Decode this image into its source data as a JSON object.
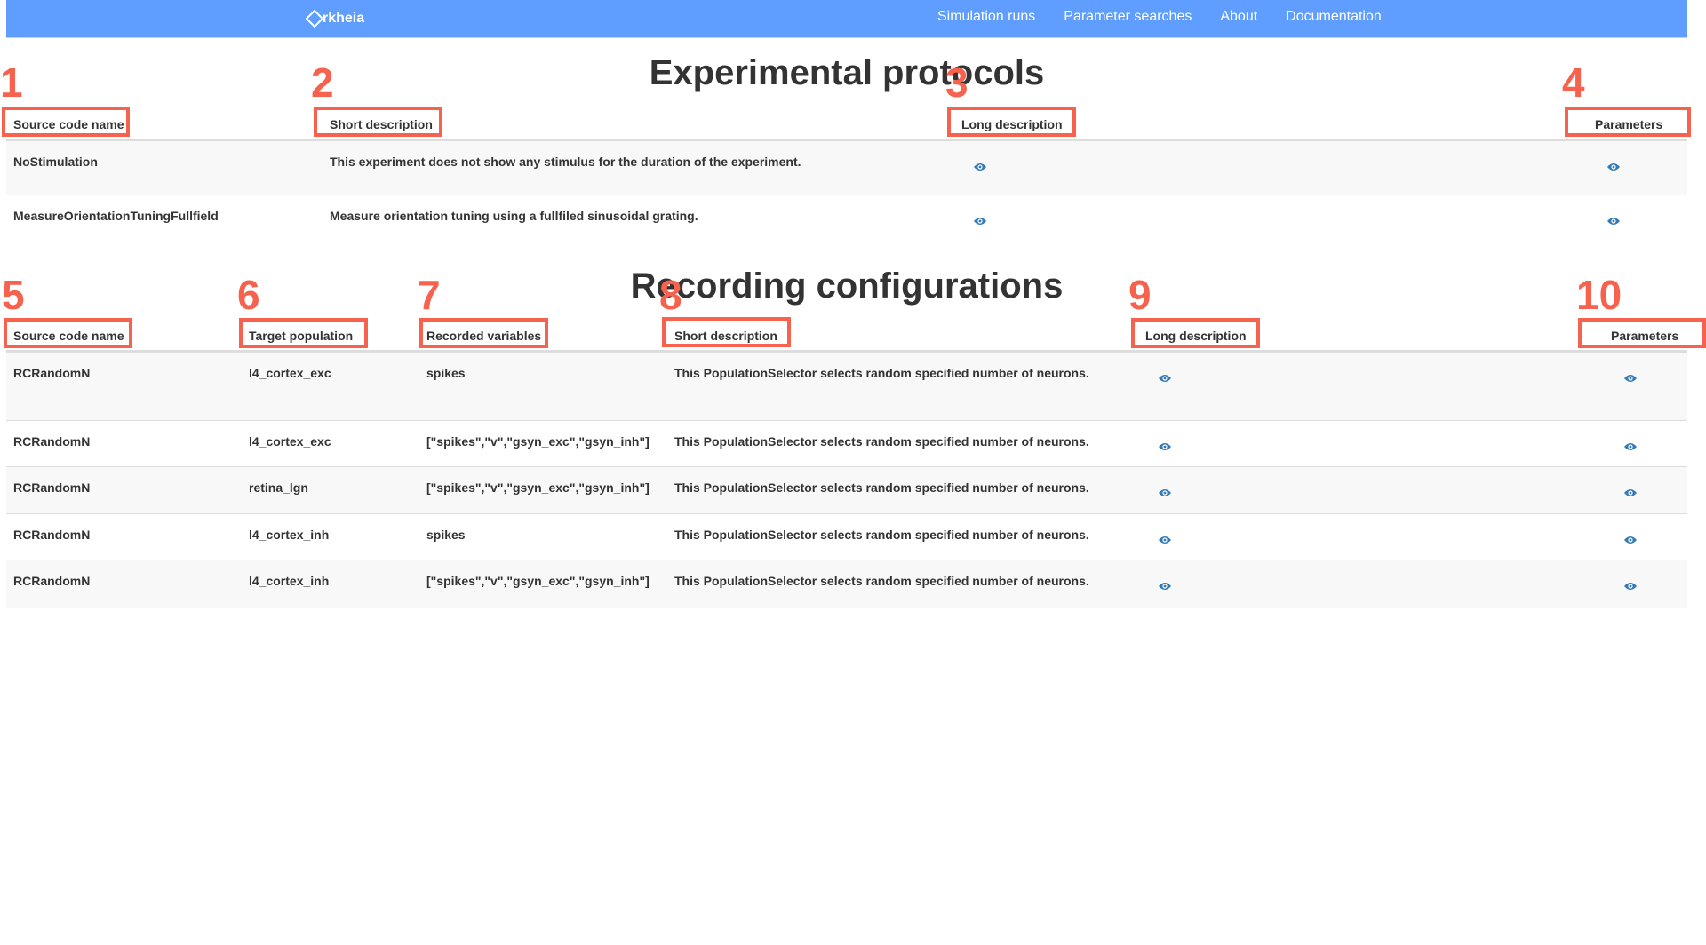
{
  "nav": {
    "logo_text": "rkheia",
    "links": [
      "Simulation runs",
      "Parameter searches",
      "About",
      "Documentation"
    ],
    "color": "#5f9dff"
  },
  "experimental_protocols": {
    "title": "Experimental protocols",
    "headers": [
      "Source code name",
      "Short description",
      "Long description",
      "Parameters"
    ],
    "rows": [
      {
        "name": "NoStimulation",
        "short": "This experiment does not show any stimulus for the duration of the experiment."
      },
      {
        "name": "MeasureOrientationTuningFullfield",
        "short": "Measure orientation tuning using a fullfiled sinusoidal grating."
      }
    ]
  },
  "recording_configurations": {
    "title": "Recording configurations",
    "headers": [
      "Source code name",
      "Target population",
      "Recorded variables",
      "Short description",
      "Long description",
      "Parameters"
    ],
    "rows": [
      {
        "name": "RCRandomN",
        "population": "l4_cortex_exc",
        "variables": "spikes",
        "short": "This PopulationSelector selects random specified number of neurons."
      },
      {
        "name": "RCRandomN",
        "population": "l4_cortex_exc",
        "variables": "[\"spikes\",\"v\",\"gsyn_exc\",\"gsyn_inh\"]",
        "short": "This PopulationSelector selects random specified number of neurons."
      },
      {
        "name": "RCRandomN",
        "population": "retina_lgn",
        "variables": "[\"spikes\",\"v\",\"gsyn_exc\",\"gsyn_inh\"]",
        "short": "This PopulationSelector selects random specified number of neurons."
      },
      {
        "name": "RCRandomN",
        "population": "l4_cortex_inh",
        "variables": "spikes",
        "short": "This PopulationSelector selects random specified number of neurons."
      },
      {
        "name": "RCRandomN",
        "population": "l4_cortex_inh",
        "variables": "[\"spikes\",\"v\",\"gsyn_exc\",\"gsyn_inh\"]",
        "short": "This PopulationSelector selects random specified number of neurons."
      }
    ]
  },
  "annotations": [
    "1",
    "2",
    "3",
    "4",
    "5",
    "6",
    "7",
    "8",
    "9",
    "10"
  ],
  "icons": {
    "view": "eye-icon",
    "color": "#337ab7"
  },
  "annotation_color": "#f7624f"
}
